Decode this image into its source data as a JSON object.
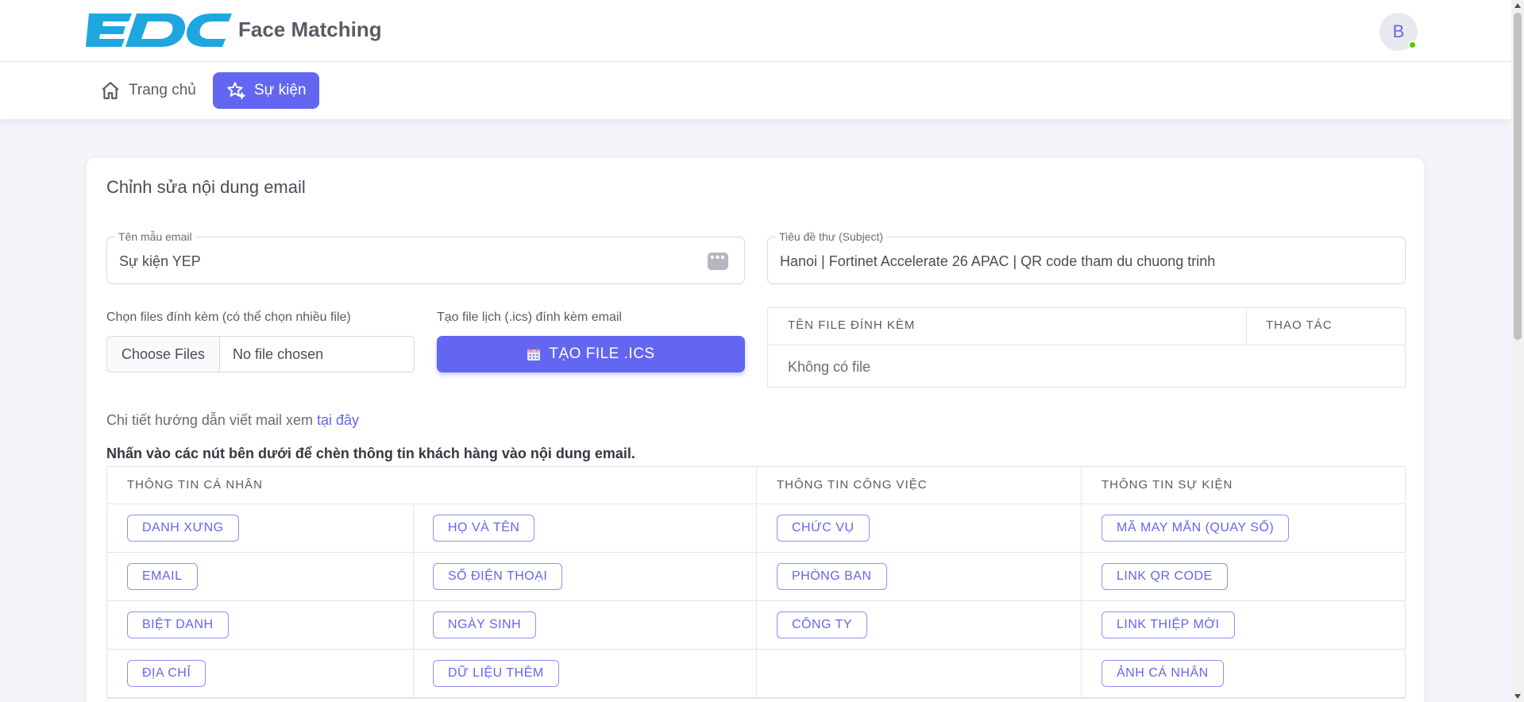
{
  "header": {
    "logo_text": "EDC",
    "app_title": "Face Matching",
    "avatar_initial": "B"
  },
  "nav": {
    "home_label": "Trang chủ",
    "events_label": "Sự kiện"
  },
  "card": {
    "title": "Chỉnh sửa nội dung email",
    "template_name": {
      "label": "Tên mẫu email",
      "value": "Sự kiện YEP"
    },
    "subject": {
      "label": "Tiêu đề thư (Subject)",
      "value": "Hanoi | Fortinet Accelerate 26 APAC | QR code tham du chuong trinh"
    },
    "attachments_label": "Chọn files đính kèm (có thể chọn nhiều file)",
    "file_button": "Choose Files",
    "file_status": "No file chosen",
    "ics_label": "Tạo file lịch (.ics) đính kèm email",
    "ics_button": "TẠO FILE .ICS",
    "attach_table": {
      "col_filename": "TÊN FILE ĐÍNH KÈM",
      "col_actions": "THAO TÁC",
      "empty": "Không có file"
    },
    "guide_text": "Chi tiết hướng dẫn viết mail xem",
    "guide_link": "tại đây",
    "insert_note": "Nhấn vào các nút bên dưới để chèn thông tin khách hàng vào nội dung email."
  },
  "tag_table": {
    "headers": [
      "THÔNG TIN CÁ NHÂN",
      "THÔNG TIN CÔNG VIỆC",
      "THÔNG TIN SỰ KIỆN"
    ],
    "rows": [
      [
        "DANH XƯNG",
        "HỌ VÀ TÊN",
        "CHỨC VỤ",
        "MÃ MAY MẮN (QUAY SỐ)"
      ],
      [
        "EMAIL",
        "SỐ ĐIỆN THOẠI",
        "PHÒNG BAN",
        "LINK QR CODE"
      ],
      [
        "BIỆT DANH",
        "NGÀY SINH",
        "CÔNG TY",
        "LINK THIỆP MỜI"
      ],
      [
        "ĐỊA CHỈ",
        "DỮ LIỆU THÊM",
        "",
        "ẢNH CÁ NHÂN"
      ]
    ]
  },
  "colors": {
    "primary": "#6366f1",
    "logo_blue": "#1ea6e0",
    "online_green": "#56ca00"
  },
  "icons": {
    "home": "home-icon",
    "events": "sparkle-star-icon",
    "more": "more-dots-icon",
    "calendar": "calendar-icon"
  }
}
